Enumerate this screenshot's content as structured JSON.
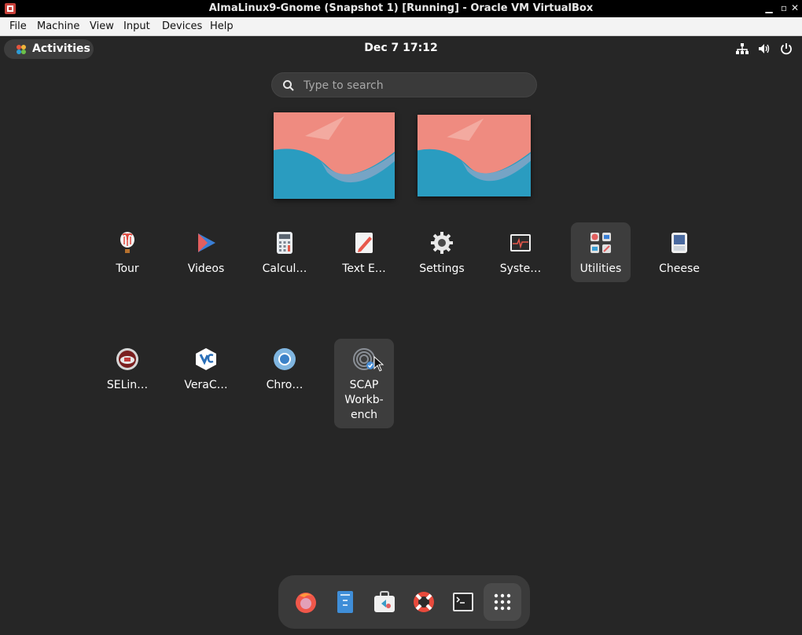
{
  "window": {
    "title": "AlmaLinux9-Gnome (Snapshot 1) [Running] - Oracle VM VirtualBox",
    "controls": [
      "minimize",
      "restore",
      "close"
    ]
  },
  "menubar": {
    "file": "File",
    "machine": "Machine",
    "view": "View",
    "input": "Input",
    "devices": "Devices",
    "help": "Help"
  },
  "topbar": {
    "activities": "Activities",
    "clock": "Dec 7  17:12",
    "tray": [
      "network-icon",
      "volume-icon",
      "power-icon"
    ]
  },
  "search": {
    "placeholder": "Type to search",
    "value": ""
  },
  "apps": [
    {
      "label": "Tour",
      "icon": "tour-icon"
    },
    {
      "label": "Videos",
      "icon": "videos-icon"
    },
    {
      "label": "Calcul…",
      "icon": "calculator-icon"
    },
    {
      "label": "Text E…",
      "icon": "text-editor-icon"
    },
    {
      "label": "Settings",
      "icon": "settings-icon"
    },
    {
      "label": "Syste…",
      "icon": "system-monitor-icon"
    },
    {
      "label": "Utilities",
      "icon": "utilities-folder-icon",
      "highlighted": true
    },
    {
      "label": "Cheese",
      "icon": "cheese-icon"
    },
    {
      "label": "SELin…",
      "icon": "selinux-icon"
    },
    {
      "label": "VeraC…",
      "icon": "veracrypt-icon"
    },
    {
      "label": "Chro…",
      "icon": "chromium-icon"
    },
    {
      "label": "SCAP\nWorkb-\nench",
      "icon": "scap-workbench-icon",
      "hovered": true
    }
  ],
  "dock": [
    {
      "name": "firefox",
      "icon": "firefox-icon"
    },
    {
      "name": "files",
      "icon": "files-icon"
    },
    {
      "name": "software",
      "icon": "software-icon"
    },
    {
      "name": "help",
      "icon": "help-icon"
    },
    {
      "name": "terminal",
      "icon": "terminal-icon"
    },
    {
      "name": "show-apps",
      "icon": "app-grid-icon"
    }
  ],
  "colors": {
    "panel": "#262626",
    "tile_highlight": "#3d3d3d",
    "wallpaper_coral": "#ef8b80",
    "wallpaper_teal": "#2a9cc0"
  }
}
